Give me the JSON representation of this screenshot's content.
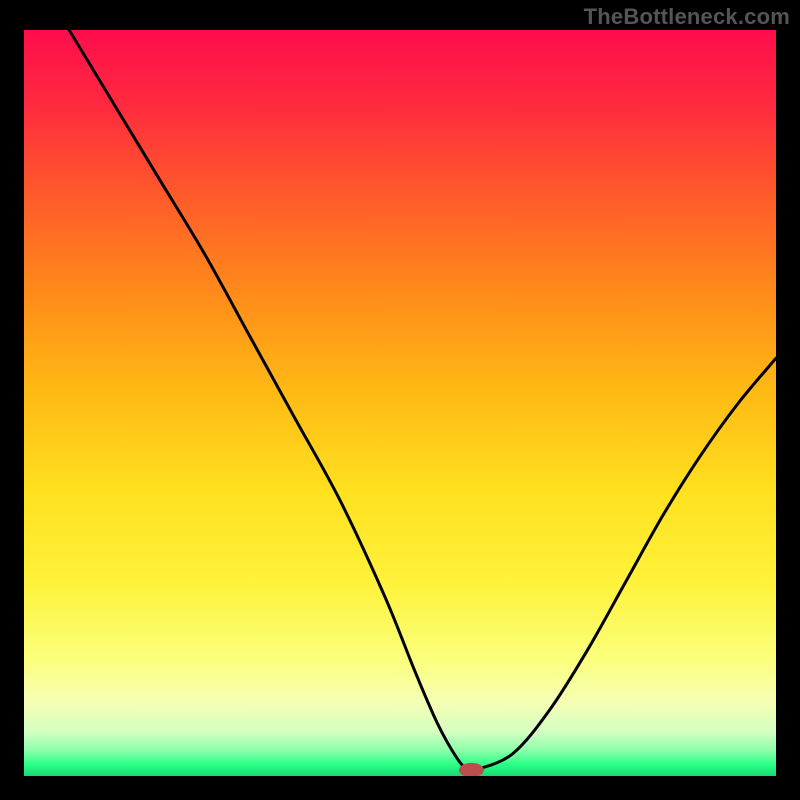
{
  "watermark": "TheBottleneck.com",
  "colors": {
    "background": "#000000",
    "curve": "#000000",
    "marker_fill": "#bb4d4d",
    "marker_stroke": "#bb4d4d",
    "gradient_stops": [
      {
        "offset": 0.0,
        "color": "#ff0d4d"
      },
      {
        "offset": 0.1,
        "color": "#ff2a3e"
      },
      {
        "offset": 0.22,
        "color": "#ff5a2a"
      },
      {
        "offset": 0.35,
        "color": "#ff8a1a"
      },
      {
        "offset": 0.48,
        "color": "#ffb814"
      },
      {
        "offset": 0.62,
        "color": "#ffe11f"
      },
      {
        "offset": 0.74,
        "color": "#fff23a"
      },
      {
        "offset": 0.84,
        "color": "#fbff7a"
      },
      {
        "offset": 0.9,
        "color": "#f5ffb3"
      },
      {
        "offset": 0.94,
        "color": "#d6ffc2"
      },
      {
        "offset": 0.965,
        "color": "#8effac"
      },
      {
        "offset": 0.985,
        "color": "#29ff85"
      },
      {
        "offset": 1.0,
        "color": "#17d873"
      }
    ]
  },
  "chart_data": {
    "type": "line",
    "title": "",
    "xlabel": "",
    "ylabel": "",
    "xlim": [
      0,
      100
    ],
    "ylim": [
      0,
      100
    ],
    "series": [
      {
        "name": "bottleneck-curve",
        "x": [
          6,
          12,
          18,
          24,
          30,
          36,
          42,
          48,
          52,
          55,
          57.5,
          59,
          60,
          65,
          70,
          75,
          80,
          85,
          90,
          95,
          100
        ],
        "y": [
          100,
          90,
          80,
          70,
          59,
          48,
          37,
          24,
          14,
          7,
          2.5,
          0.8,
          0.8,
          3,
          9,
          17,
          26,
          35,
          43,
          50,
          56
        ]
      }
    ],
    "marker": {
      "x": 59.5,
      "y": 0.8,
      "rx": 1.6,
      "ry": 0.9
    }
  }
}
